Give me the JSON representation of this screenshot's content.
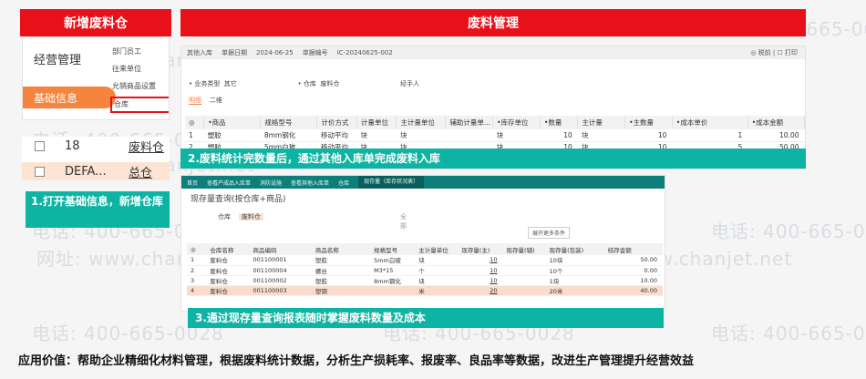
{
  "watermarks": [
    "400-665-0028",
    "网址: www.chanjet.net",
    "电话: 400-665-0028"
  ],
  "left": {
    "banner": "新增废料仓",
    "panel_title": "经营管理",
    "tab": "基础信息",
    "menu": [
      "部门员工",
      "往来单位",
      "允销商品设置",
      "仓库"
    ],
    "rows": [
      {
        "code": "18",
        "name": "废料仓"
      },
      {
        "code": "DEFA...",
        "name": "总仓"
      }
    ],
    "callout": "1.打开基础信息，新增仓库"
  },
  "top_right": {
    "banner": "废料管理",
    "doc_tab": "其他入库",
    "date_label": "单据日期",
    "date": "2024-06-25",
    "no_label": "单据编号",
    "no": "IC-20240625-002",
    "right_actions": "◎ 税前  |  ☐ 打印",
    "filters": "• 业务类型  其它                              • 仓库  废料仓                              经手人",
    "subtabs": [
      "明细",
      "二维"
    ],
    "columns": [
      "◎",
      "•商品",
      "规格型号",
      "计价方式",
      "计量单位",
      "主计量单位",
      "辅助计量单...",
      "•库存单位",
      "•数量",
      "主计量",
      "•主数量",
      "•成本单价",
      "•成本金额"
    ],
    "rows": [
      [
        "1",
        "塑胶",
        "8mm钢化",
        "移动平均",
        "块",
        "块",
        "",
        "块",
        "10",
        "块",
        "10",
        "1",
        "10.00"
      ],
      [
        "2",
        "塑胶",
        "5mm白玻",
        "移动平均",
        "块",
        "块",
        "",
        "块",
        "10",
        "块",
        "10",
        "5",
        "50.00"
      ]
    ],
    "callout": "2.废料统计完数量后，通过其他入库单完成废料入库"
  },
  "bottom": {
    "tabs": [
      "首页",
      "查看产成品入库单",
      "消防设施",
      "查看其他入库单",
      "仓库",
      "现存量（库存状况表）"
    ],
    "report_title": "现存量查询(按仓库+商品)",
    "filter_label": "仓库",
    "filter_value": "废料仓",
    "filter_hint": "全部",
    "expand": "展开更多条件",
    "columns": [
      "◎",
      "仓库名称",
      "商品编码",
      "商品名称",
      "规格型号",
      "主计量单位",
      "现存量(主)",
      "现存量(辅)",
      "现存量(包装)",
      "结存金额"
    ],
    "rows": [
      [
        "1",
        "废料仓",
        "001100001",
        "塑胶",
        "5mm白玻",
        "块",
        "10",
        "",
        "10块",
        "50.00"
      ],
      [
        "2",
        "废料仓",
        "001100004",
        "螺丝",
        "M3*15",
        "个",
        "10",
        "",
        "10个",
        "0.00"
      ],
      [
        "3",
        "废料仓",
        "001100002",
        "塑胶",
        "8mm钢化",
        "块",
        "10",
        "",
        "1块",
        "10.00"
      ],
      [
        "4",
        "废料仓",
        "001100003",
        "塑钢",
        "",
        "米",
        "20",
        "",
        "20米",
        "40.00"
      ]
    ],
    "callout": "3.通过现存量查询报表随时掌握废料数量及成本"
  },
  "footer": "应用价值：帮助企业精细化材料管理，根据废料统计数据，分析生产损耗率、报废率、良品率等数据，改进生产管理提升经营效益",
  "colors": {
    "red": "#e8111a",
    "teal": "#0db4a3",
    "orange": "#f4843e",
    "highlight": "#fbdccc"
  }
}
